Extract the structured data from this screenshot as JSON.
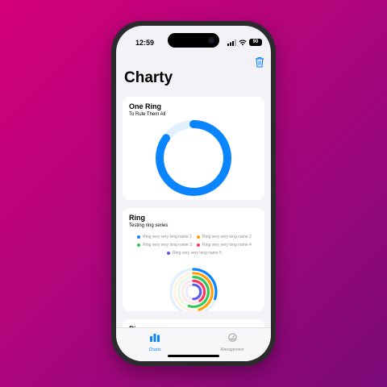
{
  "status_bar": {
    "time": "12:59",
    "battery": "90"
  },
  "app": {
    "title": "Charty"
  },
  "cards": [
    {
      "title": "One Ring",
      "subtitle": "To Rule Them All"
    },
    {
      "title": "Ring",
      "subtitle": "Testing ring series",
      "legend": [
        {
          "label": "Ring very very long name 1",
          "color": "#0a84ff"
        },
        {
          "label": "Ring very very long name 2",
          "color": "#ff9f0a"
        },
        {
          "label": "Ring very very long name 3",
          "color": "#34c759"
        },
        {
          "label": "Ring very very long name 4",
          "color": "#ff375f"
        },
        {
          "label": "Ring very very long name 5",
          "color": "#5e5ce6"
        }
      ]
    },
    {
      "title": "Pie"
    }
  ],
  "chart_data": [
    {
      "type": "pie",
      "title": "One Ring",
      "subtitle": "To Rule Them All",
      "series": [
        {
          "values": [
            0.85
          ]
        }
      ],
      "colors": [
        "#0a84ff"
      ]
    },
    {
      "type": "pie",
      "title": "Ring",
      "subtitle": "Testing ring series",
      "series": [
        {
          "name": "Ring very very long name 1",
          "values": [
            0.3
          ],
          "color": "#0a84ff"
        },
        {
          "name": "Ring very very long name 2",
          "values": [
            0.45
          ],
          "color": "#ff9f0a"
        },
        {
          "name": "Ring very very long name 3",
          "values": [
            0.55
          ],
          "color": "#34c759"
        },
        {
          "name": "Ring very very long name 4",
          "values": [
            0.4
          ],
          "color": "#ff375f"
        },
        {
          "name": "Ring very very long name 5",
          "values": [
            0.5
          ],
          "color": "#5e5ce6"
        }
      ]
    }
  ],
  "tabs": [
    {
      "label": "Charts",
      "active": true
    },
    {
      "label": "Management",
      "active": false
    }
  ],
  "colors": {
    "accent": "#0a84ff",
    "inactive": "#8e8e93",
    "background": "#f2f2f7"
  }
}
